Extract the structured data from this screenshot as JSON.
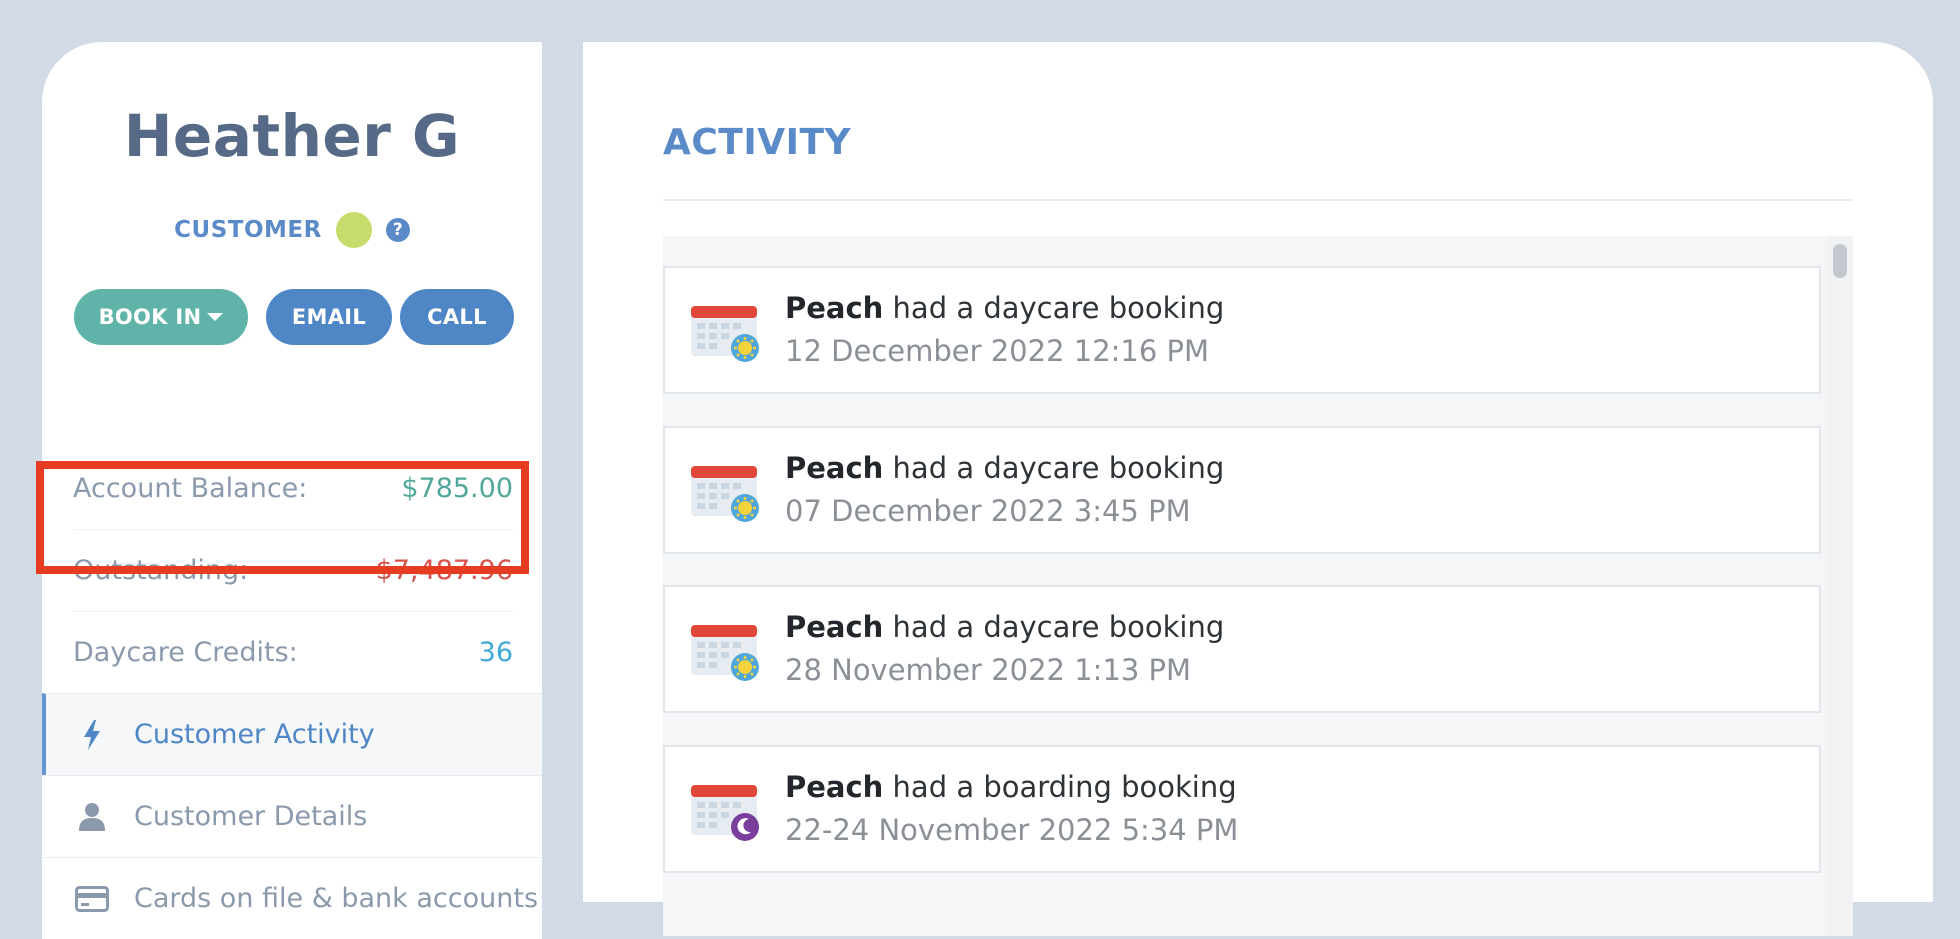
{
  "customer": {
    "name": "Heather G",
    "role": "CUSTOMER",
    "status_color": "#c6dc6b"
  },
  "actions": {
    "book_in": "BOOK IN",
    "email": "EMAIL",
    "call": "CALL"
  },
  "stats": {
    "account_balance_label": "Account Balance:",
    "account_balance_value": "$785.00",
    "outstanding_label": "Outstanding:",
    "outstanding_value": "$7,487.96",
    "daycare_credits_label": "Daycare Credits:",
    "daycare_credits_value": "36"
  },
  "nav": {
    "items": [
      {
        "label": "Customer Activity",
        "icon": "lightning-icon",
        "active": true
      },
      {
        "label": "Customer Details",
        "icon": "person-icon",
        "active": false
      },
      {
        "label": "Cards on file & bank accounts",
        "icon": "credit-card-icon",
        "active": false
      }
    ]
  },
  "activity": {
    "title": "ACTIVITY",
    "items": [
      {
        "pet": "Peach",
        "text": "had a daycare booking",
        "date": "12 December 2022 12:16 PM",
        "type": "daycare"
      },
      {
        "pet": "Peach",
        "text": "had a daycare booking",
        "date": "07 December 2022 3:45 PM",
        "type": "daycare"
      },
      {
        "pet": "Peach",
        "text": "had a daycare booking",
        "date": "28 November 2022 1:13 PM",
        "type": "daycare"
      },
      {
        "pet": "Peach",
        "text": "had a boarding booking",
        "date": "22-24 November 2022 5:34 PM",
        "type": "boarding"
      }
    ]
  },
  "colors": {
    "background": "#d1dae5",
    "accent_blue": "#4f86c6",
    "accent_teal": "#5fb3a9",
    "outstanding_red": "#d8524c",
    "highlight_red": "#e63c22"
  }
}
